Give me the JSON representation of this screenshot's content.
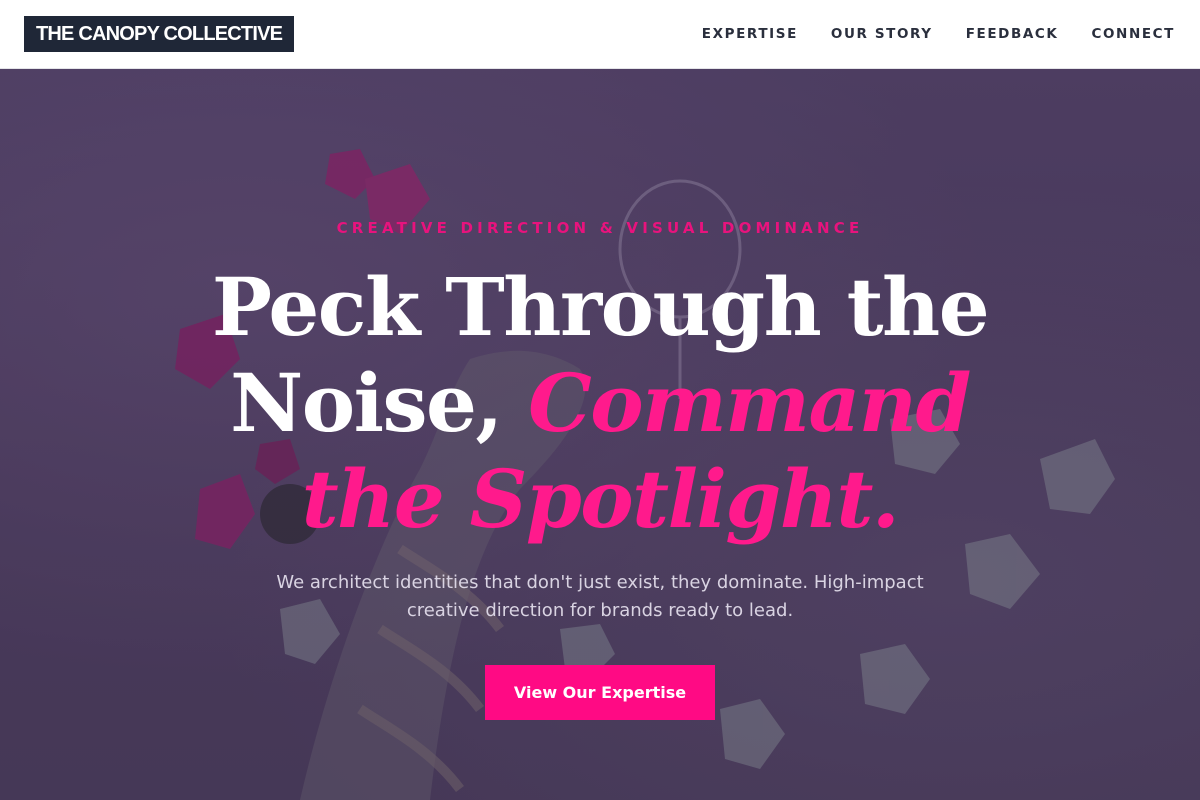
{
  "brand": {
    "name": "THE CANOPY COLLECTIVE"
  },
  "nav": {
    "items": [
      {
        "label": "EXPERTISE"
      },
      {
        "label": "OUR STORY"
      },
      {
        "label": "FEEDBACK"
      },
      {
        "label": "CONNECT"
      }
    ]
  },
  "hero": {
    "eyebrow": "CREATIVE DIRECTION & VISUAL DOMINANCE",
    "headline_plain": "Peck Through the Noise,",
    "headline_accent": "Command the Spotlight.",
    "subcopy": "We architect identities that don't just exist, they dominate. High-impact creative direction for brands ready to lead.",
    "cta_label": "View Our Expertise"
  },
  "colors": {
    "accent": "#ff0a84",
    "nav_logo_bg": "#1f2737",
    "hero_overlay": "#4f3f62",
    "headline": "#ffffff"
  }
}
